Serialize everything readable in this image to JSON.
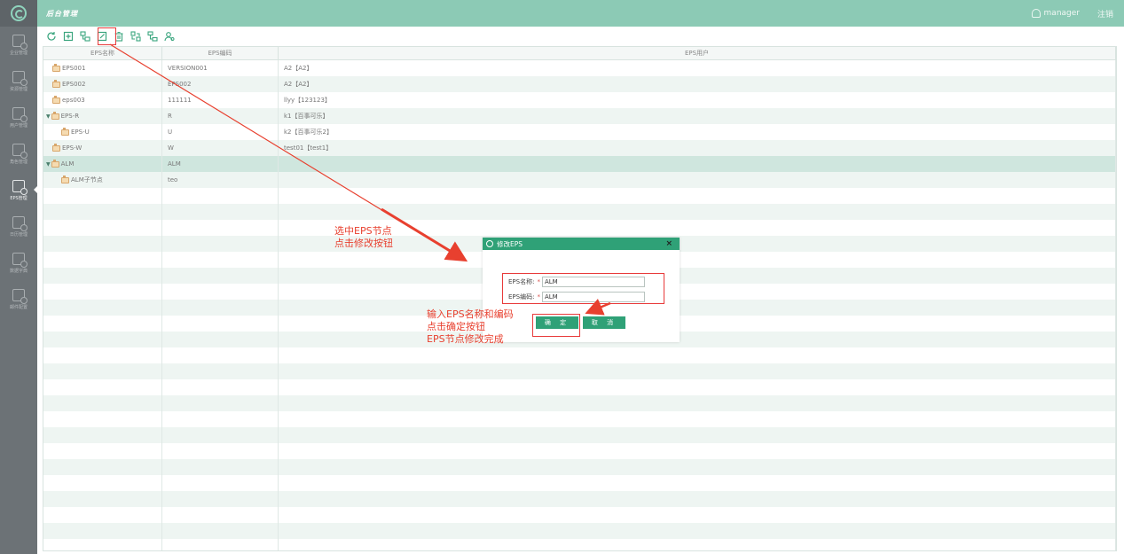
{
  "header": {
    "title": "后台管理",
    "username": "manager",
    "logout_label": "注销"
  },
  "sidebar": {
    "items": [
      {
        "label": "企业管理",
        "active": false
      },
      {
        "label": "资源管理",
        "active": false
      },
      {
        "label": "用户管理",
        "active": false
      },
      {
        "label": "角色管理",
        "active": false
      },
      {
        "label": "EPS管理",
        "active": true
      },
      {
        "label": "日历管理",
        "active": false
      },
      {
        "label": "数据字典",
        "active": false
      },
      {
        "label": "邮件配置",
        "active": false
      }
    ]
  },
  "toolbar": {
    "icons": [
      "refresh-icon",
      "add-icon",
      "add-child-icon",
      "edit-icon",
      "delete-icon",
      "move-icon",
      "sort-icon",
      "assign-user-icon"
    ]
  },
  "table": {
    "columns": [
      "EPS名称",
      "EPS编码",
      "EPS用户"
    ],
    "rows": [
      {
        "name": "EPS001",
        "code": "VERSION001",
        "users": "A2【A2】",
        "level": 0,
        "expand": false
      },
      {
        "name": "EPS002",
        "code": "EPS002",
        "users": "A2【A2】",
        "level": 0,
        "expand": false
      },
      {
        "name": "eps003",
        "code": "111111",
        "users": "llyy【123123】",
        "level": 0,
        "expand": false
      },
      {
        "name": "EPS-R",
        "code": "R",
        "users": "k1【百事可乐】",
        "level": 0,
        "expand": true
      },
      {
        "name": "EPS-U",
        "code": "U",
        "users": "k2【百事可乐2】",
        "level": 1,
        "expand": false
      },
      {
        "name": "EPS-W",
        "code": "W",
        "users": "test01【test1】",
        "level": 0,
        "expand": false
      },
      {
        "name": "ALM",
        "code": "ALM",
        "users": "",
        "level": 0,
        "expand": true,
        "selected": true
      },
      {
        "name": "ALM子节点",
        "code": "teo",
        "users": "",
        "level": 1,
        "expand": false
      }
    ]
  },
  "dialog": {
    "title": "修改EPS",
    "close": "×",
    "name_label": "EPS名称:",
    "name_value": "ALM",
    "code_label": "EPS编码:",
    "code_value": "ALM",
    "required_mark": "*",
    "ok_label": "确 定",
    "cancel_label": "取 消"
  },
  "annotations": {
    "step1": [
      "选中EPS节点",
      "点击修改按钮"
    ],
    "step2": [
      "输入EPS名称和编码",
      "点击确定按钮",
      "EPS节点修改完成"
    ],
    "color": "#e8402f"
  }
}
